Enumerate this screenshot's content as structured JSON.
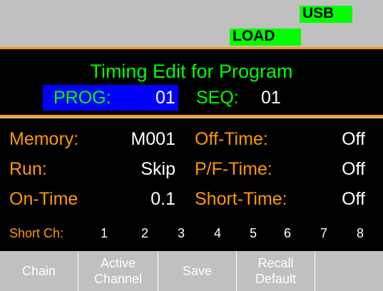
{
  "status": {
    "usb": "USB",
    "load": "LOAD"
  },
  "header": {
    "title": "Timing Edit for Program",
    "prog_label": "PROG:",
    "prog_value": "01",
    "seq_label": "SEQ:",
    "seq_value": "01"
  },
  "fields": {
    "memory_label": "Memory:",
    "memory_value": "M001",
    "offtime_label": "Off-Time:",
    "offtime_value": "Off",
    "run_label": "Run:",
    "run_value": "Skip",
    "pftime_label": "P/F-Time:",
    "pftime_value": "Off",
    "ontime_label": "On-Time",
    "ontime_value": "0.1",
    "shorttime_label": "Short-Time:",
    "shorttime_value": "Off",
    "shortch_label": "Short Ch:",
    "channels": [
      "1",
      "2",
      "3",
      "4",
      "5",
      "6",
      "7",
      "8"
    ]
  },
  "softkeys": {
    "chain": "Chain",
    "active_line1": "Active",
    "active_line2": "Channel",
    "save": "Save",
    "recall_line1": "Recall",
    "recall_line2": "Default",
    "blank": ""
  },
  "colors": {
    "accent_green": "#00ff00",
    "accent_orange": "#ff9900",
    "highlight_blue": "#0000ff"
  }
}
